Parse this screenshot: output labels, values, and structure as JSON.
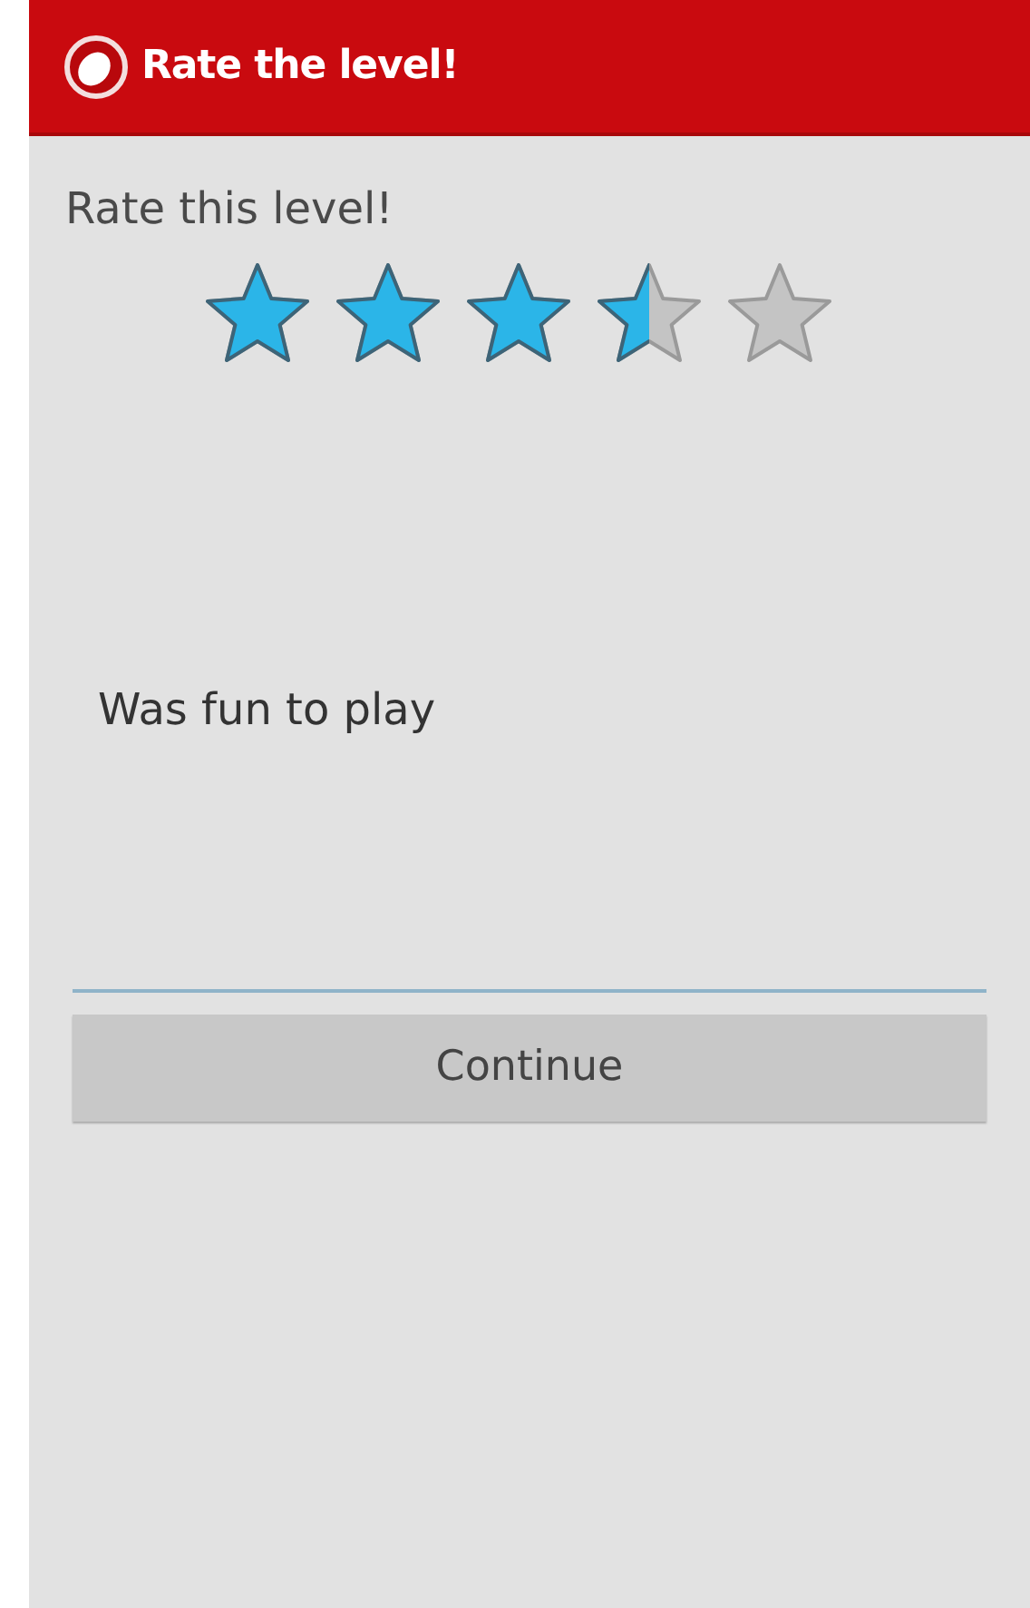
{
  "action_bar": {
    "title": "Rate the level!"
  },
  "rating": {
    "label": "Rate this level!",
    "stars": 3.5
  },
  "comment_field": {
    "value": "Was fun to play"
  },
  "buttons": [
    {
      "label": "Continue"
    }
  ]
}
